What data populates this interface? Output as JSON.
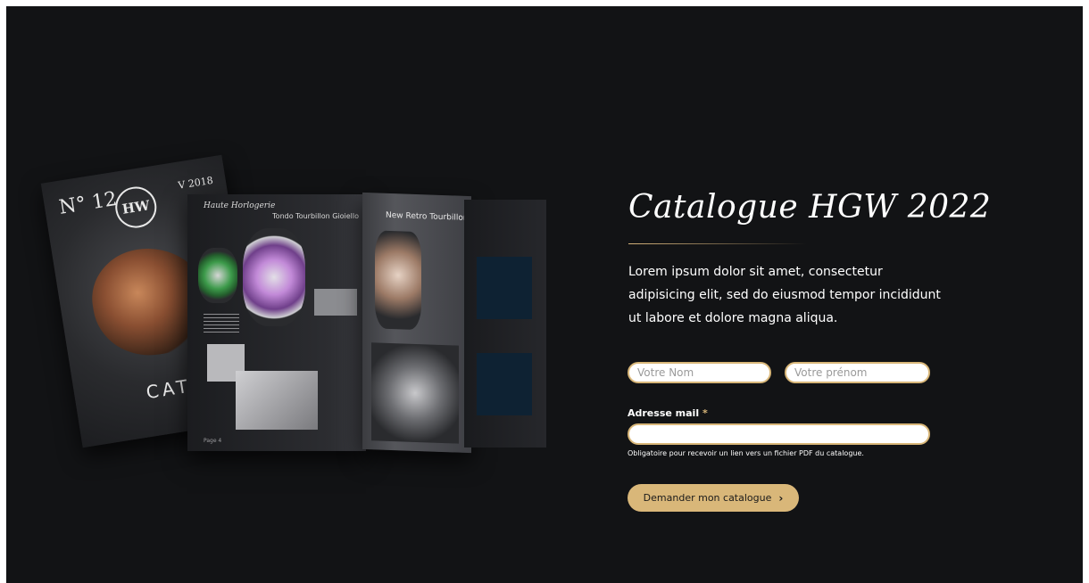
{
  "catalogue": {
    "title": "Catalogue HGW 2022",
    "description": "Lorem ipsum dolor sit amet, consectetur adipisicing elit, sed do eiusmod tempor incididunt ut labore et dolore magna aliqua."
  },
  "visual": {
    "cover_number": "N° 12",
    "cover_logo": "HW",
    "cover_year": "V 2018",
    "cover_text": "CAT",
    "left_page_header": "Haute Horlogerie",
    "left_page_title": "Tondo Tourbillon Gioiello",
    "middle_page_title": "New Retro Tourbillon",
    "left_page_number": "Page 4"
  },
  "form": {
    "name_placeholder": "Votre Nom",
    "firstname_placeholder": "Votre prénom",
    "email_label": "Adresse mail",
    "required_mark": "*",
    "email_hint": "Obligatoire pour recevoir un lien vers un fichier PDF du catalogue.",
    "submit_label": "Demander mon catalogue",
    "submit_icon": "chevron-right-icon"
  },
  "colors": {
    "background": "#121315",
    "accent": "#d9b779",
    "text": "#ffffff"
  }
}
